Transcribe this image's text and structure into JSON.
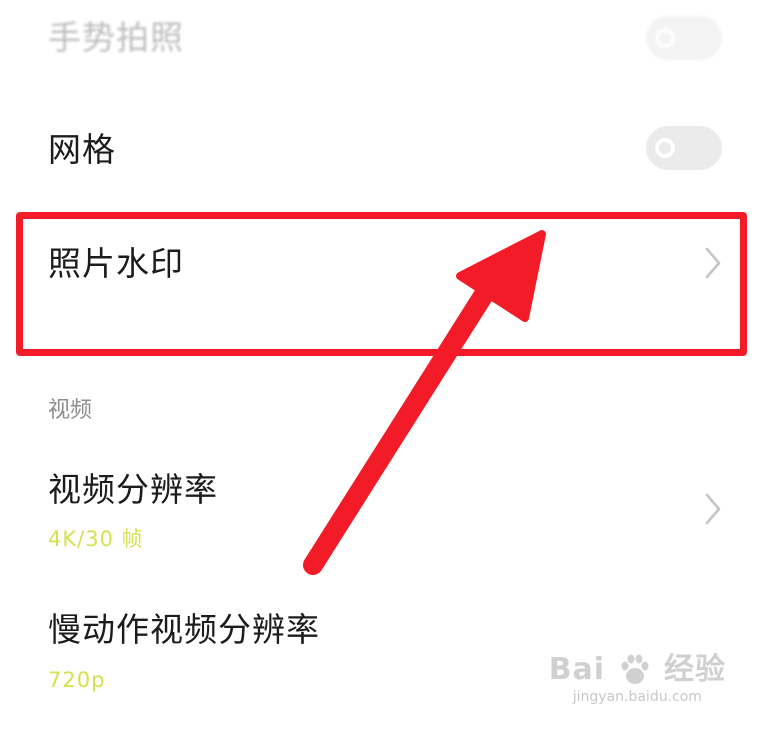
{
  "settings": {
    "gesture_capture": {
      "label": "手势拍照",
      "toggle_on": false
    },
    "grid": {
      "label": "网格",
      "toggle_on": false
    },
    "photo_watermark": {
      "label": "照片水印"
    },
    "video_section": {
      "header": "视频",
      "resolution": {
        "label": "视频分辨率",
        "value": "4K/30 帧"
      },
      "slow_motion_resolution": {
        "label": "慢动作视频分辨率",
        "value": "720p"
      }
    }
  },
  "annotation": {
    "highlight_color": "#f21b27",
    "arrow_color": "#f21b27"
  },
  "watermark": {
    "brand_left": "Bai",
    "brand_right": "经验",
    "url": "jingyan.baidu.com"
  },
  "icons": {
    "chevron": "chevron-right-icon",
    "paw": "baidu-paw-icon"
  },
  "colors": {
    "background": "#ffffff",
    "text_primary": "#1c1c1c",
    "section_header": "#8d8d8d",
    "value_accent": "#d6e14e",
    "toggle_off": "#ebebeb"
  }
}
